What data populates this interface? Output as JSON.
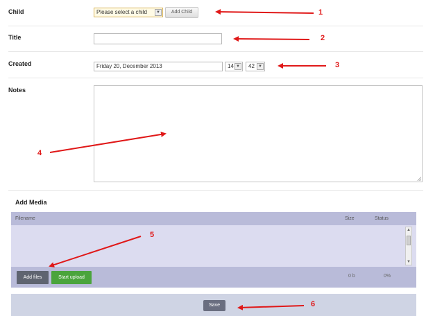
{
  "form": {
    "child": {
      "label": "Child",
      "select_value": "Please select a child",
      "add_button": "Add Child"
    },
    "title": {
      "label": "Title",
      "value": ""
    },
    "created": {
      "label": "Created",
      "date_value": "Friday 20, December 2013",
      "hour_value": "14",
      "minute_value": "42"
    },
    "notes": {
      "label": "Notes",
      "value": ""
    }
  },
  "media": {
    "section_title": "Add Media",
    "columns": [
      "Filename",
      "Size",
      "Status"
    ],
    "add_files_button": "Add files",
    "start_upload_button": "Start upload",
    "total_size": "0 b",
    "total_status": "0%"
  },
  "save_button": "Save",
  "annotations": [
    "1",
    "2",
    "3",
    "4",
    "5",
    "6"
  ],
  "colors": {
    "annotation": "#e01818",
    "start_upload": "#4aa43c",
    "media_bar": "#b9bbd9",
    "media_list": "#dcdcf0"
  },
  "icons": {
    "dropdown": "chevron-down-icon",
    "scroll_up": "arrow-up-icon",
    "scroll_down": "arrow-down-icon",
    "resize": "resize-grip-icon",
    "annotation_arrow": "arrow-icon"
  }
}
